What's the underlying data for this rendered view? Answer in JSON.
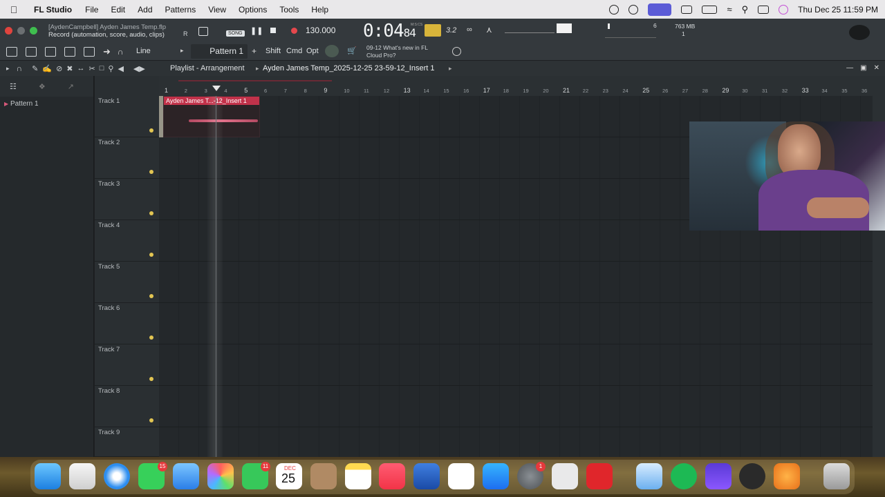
{
  "menubar": {
    "app": "FL Studio",
    "items": [
      "File",
      "Edit",
      "Add",
      "Patterns",
      "View",
      "Options",
      "Tools",
      "Help"
    ],
    "clock": "Thu Dec 25  11:59 PM"
  },
  "flstudio": {
    "file_line1": "[AydenCampbell] Ayden James Temp.flp",
    "file_line2": "Record  (automation, score, audio, clips)",
    "song_badge": "SONG",
    "tempo": "130.000",
    "time_main": "0:04",
    "time_sub": "84",
    "time_units": "M:S:CS",
    "time_sig_hint": "3.2",
    "memory": "763 MB",
    "memory_sub": "1",
    "cpu_val": "6"
  },
  "toolbar2": {
    "snap_label": "Line",
    "pattern_label": "Pattern 1",
    "shift_label": "Shift",
    "cmd_label": "Cmd",
    "opt_label": "Opt",
    "news_line1": "09-12  What's new in FL",
    "news_line2": "Cloud Pro?"
  },
  "playlist": {
    "title": "Playlist - Arrangement",
    "subtitle": "Ayden James Temp_2025-12-25 23-59-12_Insert 1",
    "pattern_item": "Pattern 1",
    "clip_label": "Ayden James T...-12_Insert 1",
    "tracks": [
      "Track 1",
      "Track 2",
      "Track 3",
      "Track 4",
      "Track 5",
      "Track 6",
      "Track 7",
      "Track 8",
      "Track 9"
    ],
    "ruler": [
      "1",
      "2",
      "3",
      "4",
      "5",
      "6",
      "7",
      "8",
      "9",
      "10",
      "11",
      "12",
      "13",
      "14",
      "15",
      "16",
      "17",
      "18",
      "19",
      "20",
      "21",
      "22",
      "23",
      "24",
      "25",
      "26",
      "27",
      "28",
      "29",
      "30",
      "31",
      "32",
      "33",
      "34",
      "35",
      "36"
    ]
  },
  "dock": {
    "calendar_month": "DEC",
    "calendar_day": "25",
    "badges": {
      "messages": "15",
      "facetime": "11",
      "settings": "1"
    }
  }
}
